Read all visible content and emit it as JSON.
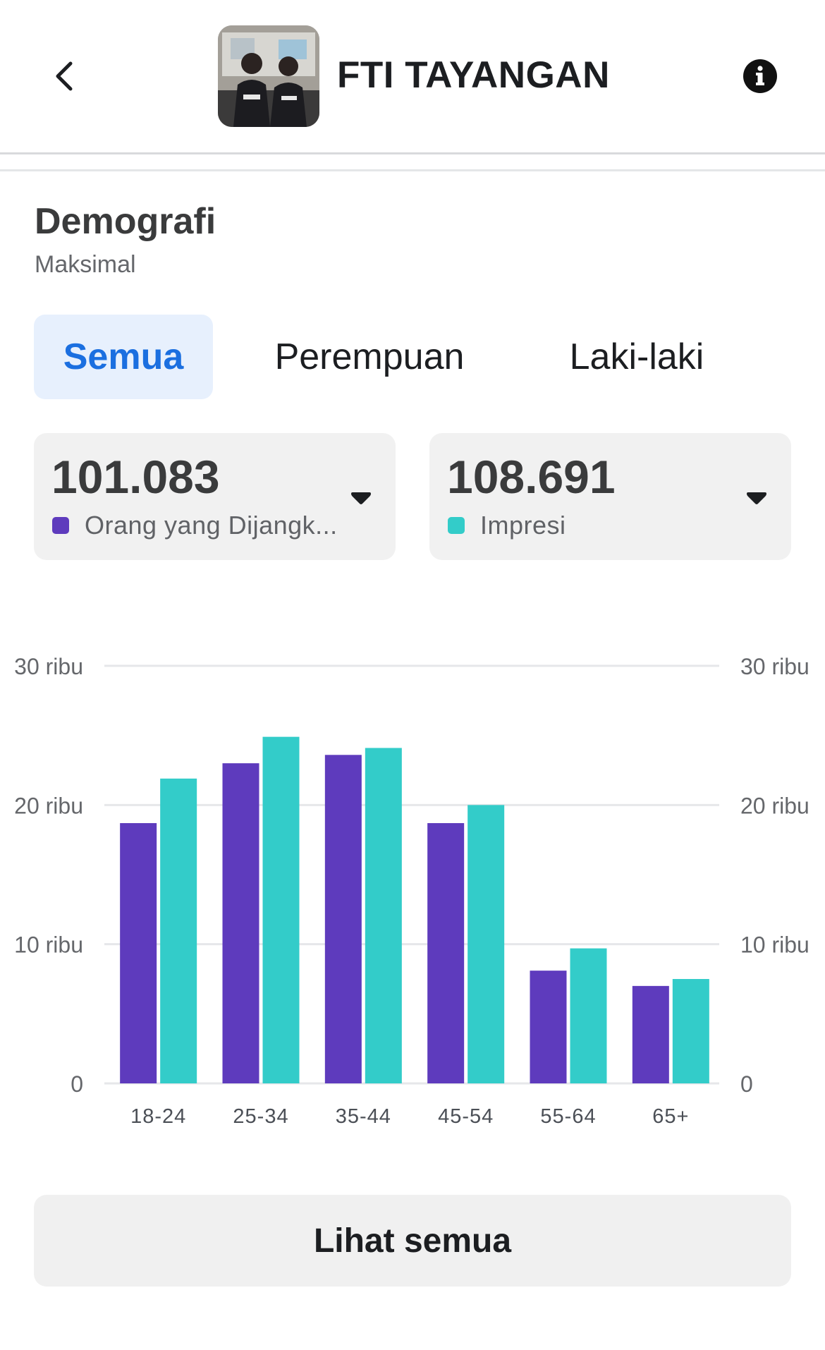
{
  "header": {
    "title": "FTI TAYANGAN",
    "back_icon": "chevron-left-icon",
    "info_icon": "info-icon"
  },
  "section": {
    "title": "Demografi",
    "subtitle": "Maksimal"
  },
  "tabs": [
    {
      "label": "Semua",
      "active": true
    },
    {
      "label": "Perempuan",
      "active": false
    },
    {
      "label": "Laki-laki",
      "active": false
    }
  ],
  "metrics": [
    {
      "value": "101.083",
      "label": "Orang yang Dijangk...",
      "color": "#5e3bbd"
    },
    {
      "value": "108.691",
      "label": "Impresi",
      "color": "#33ccc9"
    }
  ],
  "chart_data": {
    "type": "bar",
    "categories": [
      "18-24",
      "25-34",
      "35-44",
      "45-54",
      "55-64",
      "65+"
    ],
    "series": [
      {
        "values": [
          18700,
          23000,
          23600,
          18700,
          8100,
          7000
        ],
        "color": "#5e3bbd"
      },
      {
        "values": [
          21900,
          24900,
          24100,
          20000,
          9700,
          7500
        ],
        "color": "#33ccc9"
      }
    ],
    "ylim": [
      0,
      30000
    ],
    "y_ticks_left": [
      "0",
      "10 ribu",
      "20 ribu",
      "30 ribu"
    ],
    "y_ticks_right": [
      "0",
      "10 ribu",
      "20 ribu",
      "30 ribu"
    ],
    "y_tick_values": [
      0,
      10000,
      20000,
      30000
    ],
    "grid": true
  },
  "footer": {
    "button_label": "Lihat semua"
  }
}
